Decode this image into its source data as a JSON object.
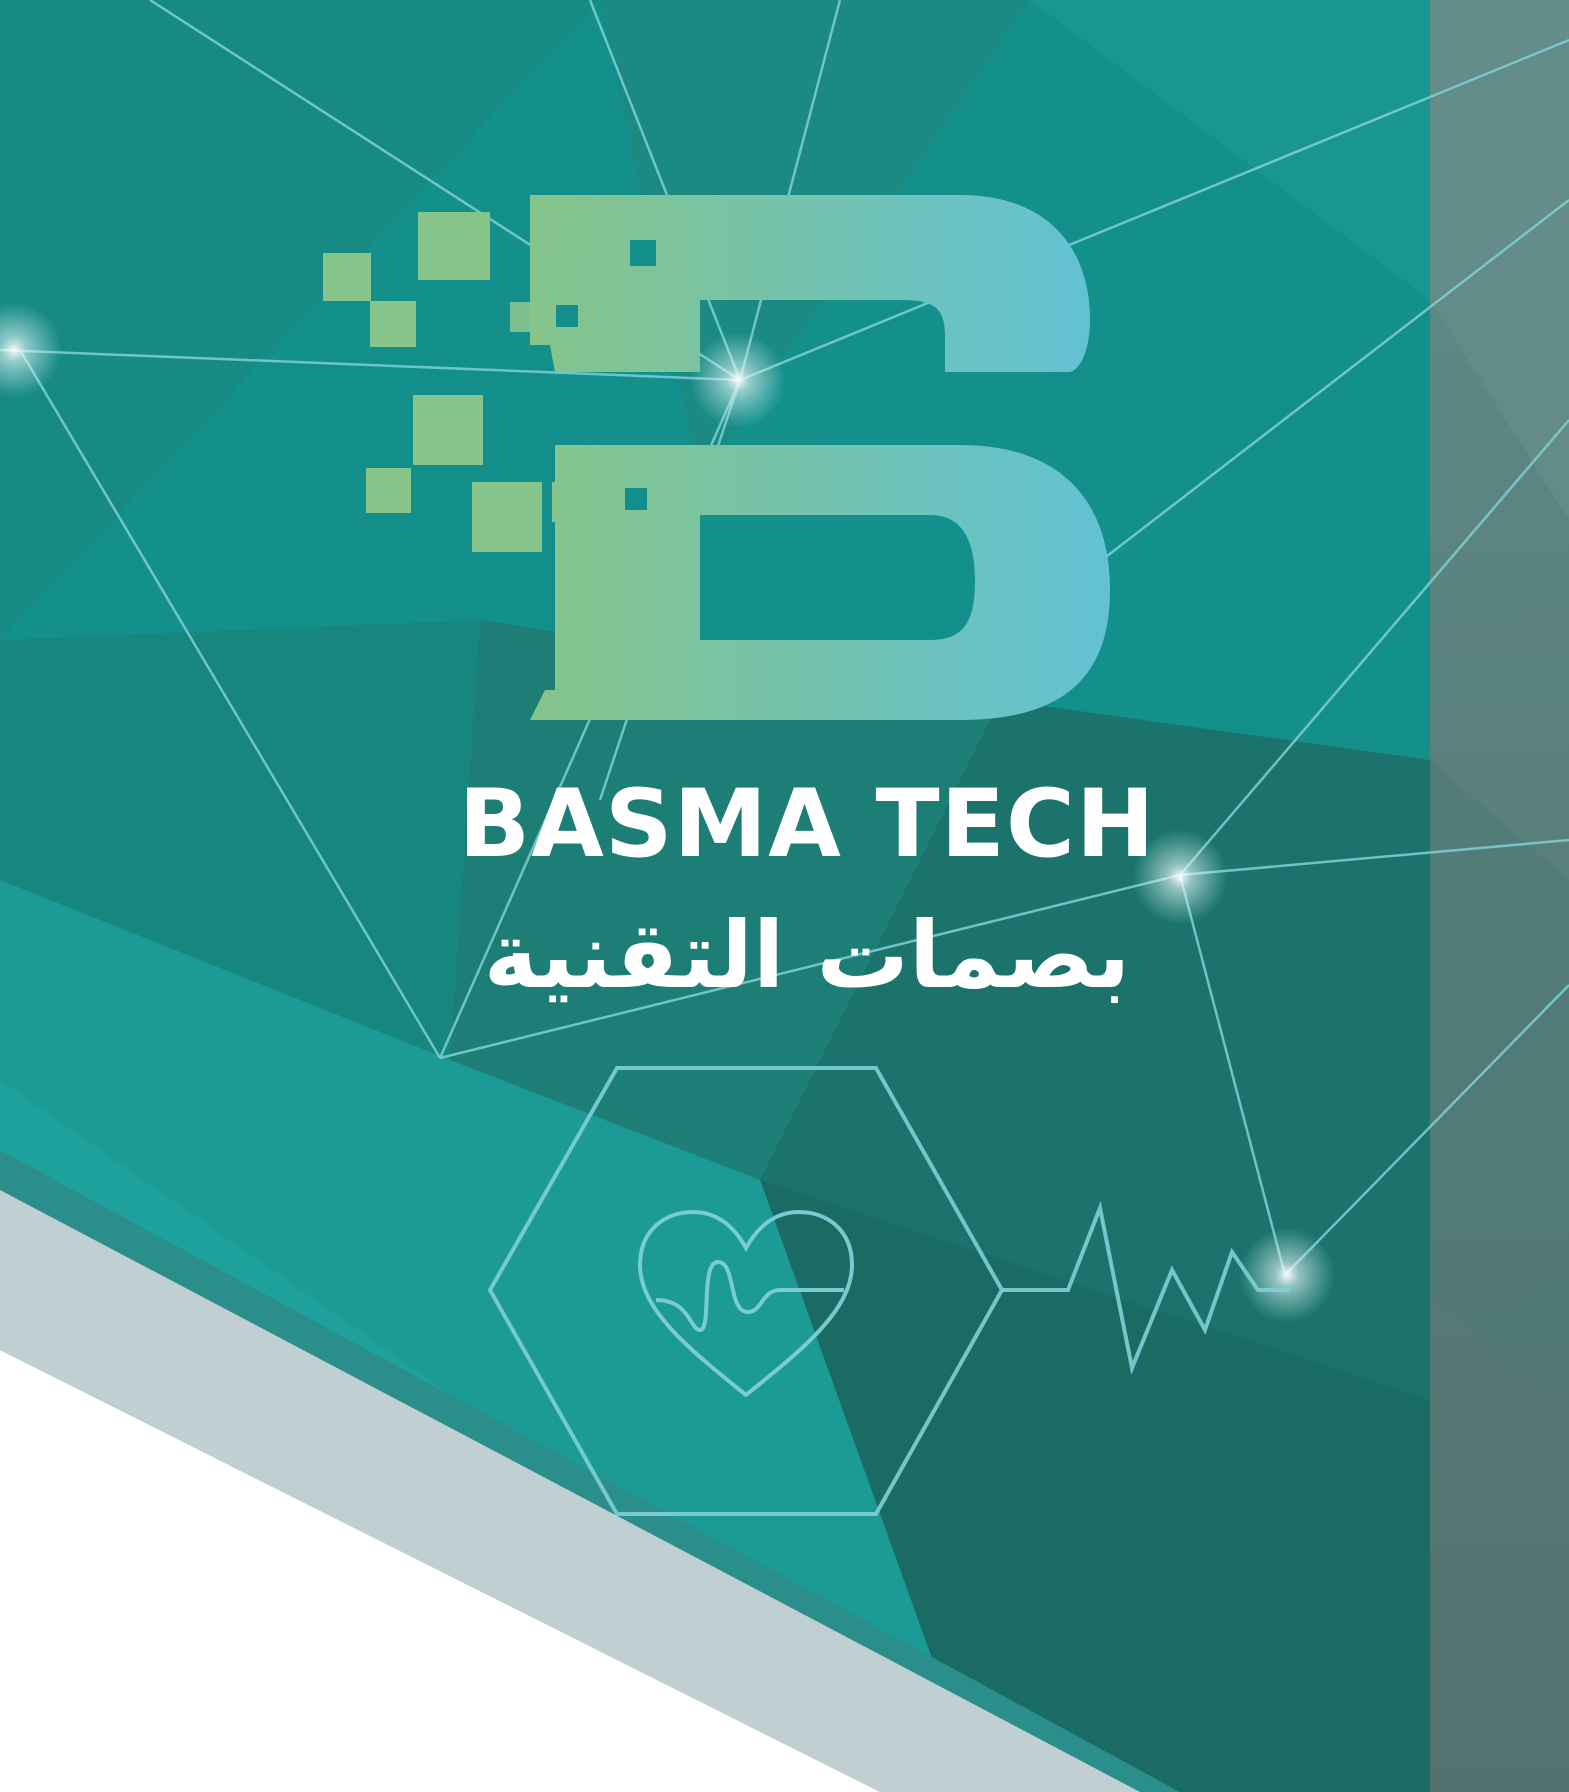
{
  "brand": {
    "name": "BASMA TECH",
    "name_arabic": "بصمات التقنية",
    "logo_letter": "B"
  },
  "colors": {
    "background_teal": "#138f8b",
    "dark_teal": "#1b6f68",
    "side_panel": "#5b8581",
    "light_stripe": "#bfced1",
    "logo_gradient_start": "#86c48a",
    "logo_gradient_end": "#62c2d4",
    "network_line": "#7fcfd6"
  },
  "icons": [
    "heart-pulse-icon",
    "hexagon-frame",
    "ecg-line"
  ]
}
